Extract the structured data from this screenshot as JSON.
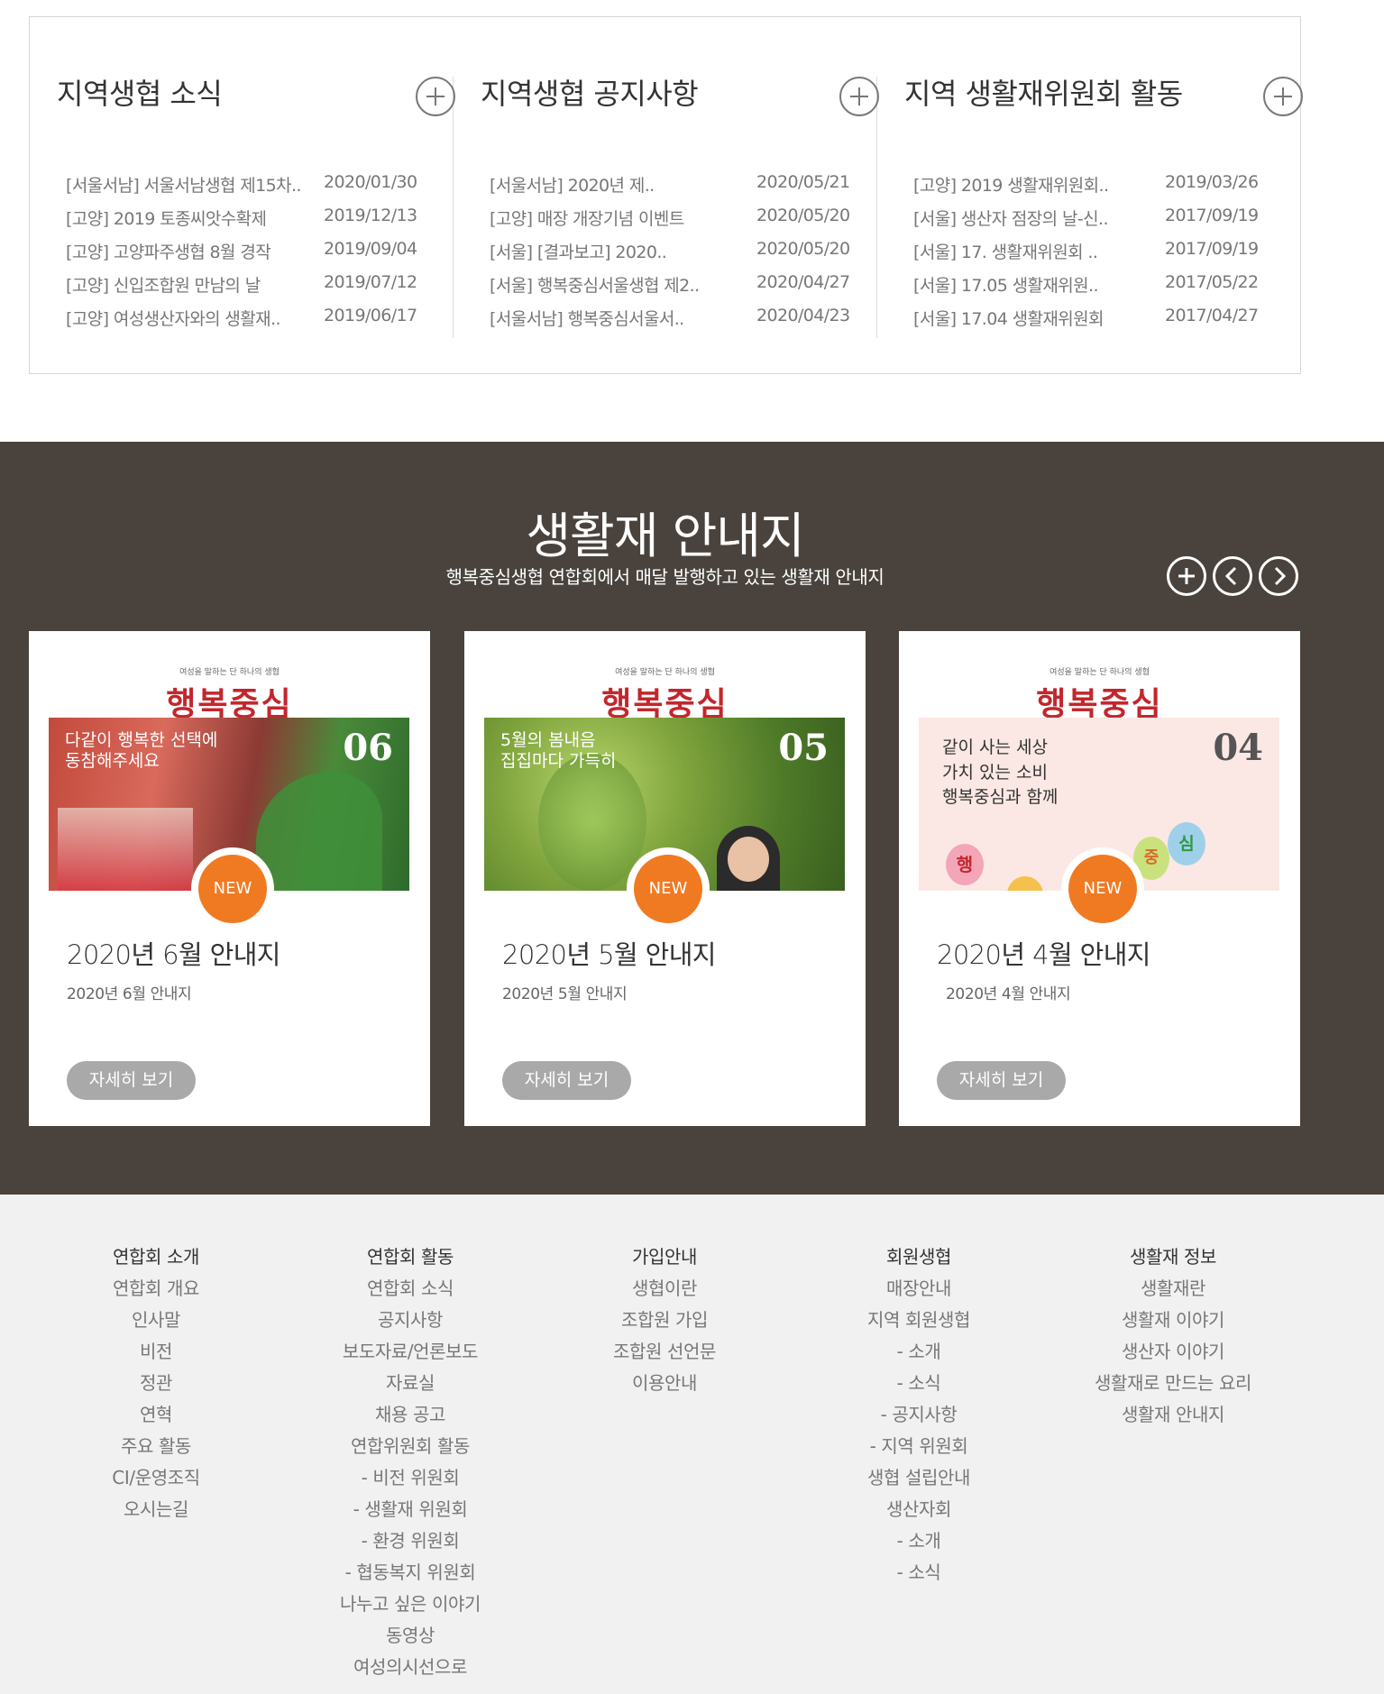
{
  "news": {
    "columns": [
      {
        "title": "지역생협 소식",
        "items": [
          {
            "title": "[서울서남] 서울서남생협 제15차..",
            "date": "2020/01/30"
          },
          {
            "title": "[고양] 2019 토종씨앗수확제",
            "date": "2019/12/13"
          },
          {
            "title": "[고양] 고양파주생협 8월 경작",
            "date": "2019/09/04"
          },
          {
            "title": "[고양] 신입조합원 만남의 날",
            "date": "2019/07/12"
          },
          {
            "title": "[고양] 여성생산자와의 생활재..",
            "date": "2019/06/17"
          }
        ]
      },
      {
        "title": "지역생협 공지사항",
        "items": [
          {
            "title": "[서울서남] 2020년 제..",
            "date": "2020/05/21"
          },
          {
            "title": "[고양] 매장 개장기념 이벤트",
            "date": "2020/05/20"
          },
          {
            "title": "[서울] [결과보고] 2020..",
            "date": "2020/05/20"
          },
          {
            "title": "[서울] 행복중심서울생협 제2..",
            "date": "2020/04/27"
          },
          {
            "title": "[서울서남] 행복중심서울서..",
            "date": "2020/04/23"
          }
        ]
      },
      {
        "title": "지역 생활재위원회 활동",
        "items": [
          {
            "title": "[고양] 2019 생활재위원회..",
            "date": "2019/03/26"
          },
          {
            "title": "[서울] 생산자 점장의 날-신..",
            "date": "2017/09/19"
          },
          {
            "title": "[서울] 17. 생활재위원회 ..",
            "date": "2017/09/19"
          },
          {
            "title": "[서울] 17.05 생활재위원..",
            "date": "2017/05/22"
          },
          {
            "title": "[서울] 17.04 생활재위원회",
            "date": "2017/04/27"
          }
        ]
      }
    ]
  },
  "guide": {
    "title": "생활재 안내지",
    "subtitle": "행복중심생협 연합회에서 매달 발행하고 있는 생활재 안내지",
    "cards": [
      {
        "masthead_sub": "여성을 말하는 단 하나의 생협",
        "brand": "행복중심",
        "issue": "06",
        "headline": "다같이 행복한 선택에\n동참해주세요",
        "badge": "NEW",
        "title": "2020년 6월 안내지",
        "desc": "2020년 6월 안내지",
        "button": "자세히 보기"
      },
      {
        "masthead_sub": "여성을 말하는 단 하나의 생협",
        "brand": "행복중심",
        "issue": "05",
        "headline": "5월의 봄내음\n집집마다 가득히",
        "badge": "NEW",
        "title": "2020년 5월 안내지",
        "desc": "2020년 5월 안내지",
        "button": "자세히 보기"
      },
      {
        "masthead_sub": "여성을 말하는 단 하나의 생협",
        "brand": "행복중심",
        "issue": "04",
        "headline": "같이 사는 세상\n가치 있는 소비\n행복중심과 함께",
        "balloons": [
          "행",
          "중",
          "심"
        ],
        "badge": "NEW",
        "title": "2020년 4월 안내지",
        "desc": "2020년 4월 안내지",
        "button": "자세히 보기"
      }
    ]
  },
  "footer": {
    "columns": [
      {
        "head": "연합회 소개",
        "items": [
          "연합회 개요",
          "인사말",
          "비전",
          "정관",
          "연혁",
          "주요 활동",
          "CI/운영조직",
          "오시는길"
        ]
      },
      {
        "head": "연합회 활동",
        "items": [
          "연합회 소식",
          "공지사항",
          "보도자료/언론보도",
          "자료실",
          "채용 공고",
          "연합위원회 활동",
          "- 비전 위원회",
          "- 생활재 위원회",
          "- 환경 위원회",
          "- 협동복지 위원회",
          "나누고 싶은 이야기",
          "동영상",
          "여성의시선으로"
        ]
      },
      {
        "head": "가입안내",
        "items": [
          "생협이란",
          "조합원 가입",
          "조합원 선언문",
          "이용안내"
        ]
      },
      {
        "head": "회원생협",
        "items": [
          "매장안내",
          "지역 회원생협",
          "- 소개",
          "- 소식",
          "- 공지사항",
          "- 지역 위원회",
          "생협 설립안내",
          "생산자회",
          "- 소개",
          "- 소식"
        ]
      },
      {
        "head": "생활재 정보",
        "items": [
          "생활재란",
          "생활재 이야기",
          "생산자 이야기",
          "생활재로 만드는 요리",
          "생활재 안내지"
        ]
      }
    ]
  },
  "colors": {
    "guide_bg": "#4a433d",
    "brand_red": "#c2272d",
    "badge_orange": "#f07a22",
    "footer_bg": "#f1f1f1",
    "button_gray": "#a9a9a9"
  }
}
